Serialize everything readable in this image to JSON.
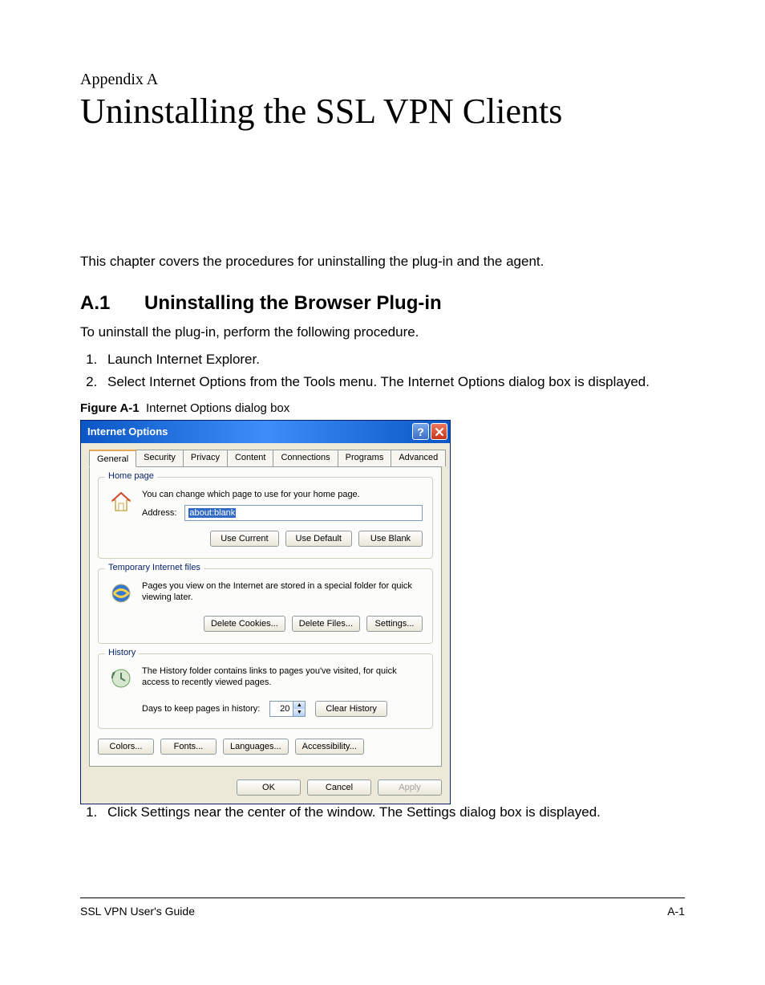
{
  "appendix_label": "Appendix A",
  "chapter_title": "Uninstalling the SSL VPN Clients",
  "intro": "This chapter covers the procedures for uninstalling the plug-in and the agent.",
  "section": {
    "number": "A.1",
    "title": "Uninstalling the Browser Plug-in",
    "desc": "To uninstall the plug-in, perform the following procedure."
  },
  "steps_a": [
    "Launch Internet Explorer.",
    "Select Internet Options from the Tools menu. The Internet Options dialog box is displayed."
  ],
  "figure": {
    "label": "Figure A-1",
    "caption": "Internet Options dialog box"
  },
  "dialog": {
    "title": "Internet Options",
    "tabs": [
      "General",
      "Security",
      "Privacy",
      "Content",
      "Connections",
      "Programs",
      "Advanced"
    ],
    "home_page": {
      "title": "Home page",
      "desc": "You can change which page to use for your home page.",
      "address_label": "Address:",
      "address_value": "about:blank",
      "buttons": [
        "Use Current",
        "Use Default",
        "Use Blank"
      ]
    },
    "temp_files": {
      "title": "Temporary Internet files",
      "desc": "Pages you view on the Internet are stored in a special folder for quick viewing later.",
      "buttons": [
        "Delete Cookies...",
        "Delete Files...",
        "Settings..."
      ]
    },
    "history": {
      "title": "History",
      "desc": "The History folder contains links to pages you've visited, for quick access to recently viewed pages.",
      "days_label": "Days to keep pages in history:",
      "days_value": "20",
      "clear_button": "Clear History"
    },
    "bottom_buttons": [
      "Colors...",
      "Fonts...",
      "Languages...",
      "Accessibility..."
    ],
    "footer_buttons": {
      "ok": "OK",
      "cancel": "Cancel",
      "apply": "Apply"
    }
  },
  "steps_b": [
    "Click Settings near the center of the window. The Settings dialog box is displayed."
  ],
  "footer": {
    "left": "SSL VPN User's Guide",
    "right": "A-1"
  }
}
